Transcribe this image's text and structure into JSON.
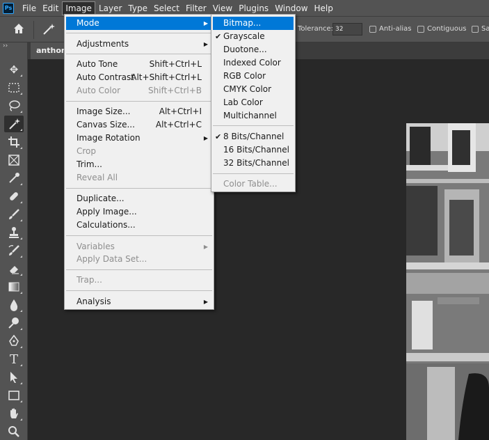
{
  "menubar": {
    "logo": "Ps",
    "items": [
      "File",
      "Edit",
      "Image",
      "Layer",
      "Type",
      "Select",
      "Filter",
      "View",
      "Plugins",
      "Window",
      "Help"
    ]
  },
  "options": {
    "tolerance_label": "Tolerance:",
    "tolerance_value": "32",
    "anti_alias_label": "Anti-alias",
    "contiguous_label": "Contiguous",
    "sample_label": "Sa"
  },
  "toolbar": {
    "collapse": "››"
  },
  "document": {
    "tab_title": "anthony"
  },
  "image_menu": {
    "mode": "Mode",
    "adjustments": "Adjustments",
    "auto_tone": "Auto Tone",
    "auto_tone_sc": "Shift+Ctrl+L",
    "auto_contrast": "Auto Contrast",
    "auto_contrast_sc": "Alt+Shift+Ctrl+L",
    "auto_color": "Auto Color",
    "auto_color_sc": "Shift+Ctrl+B",
    "image_size": "Image Size...",
    "image_size_sc": "Alt+Ctrl+I",
    "canvas_size": "Canvas Size...",
    "canvas_size_sc": "Alt+Ctrl+C",
    "image_rotation": "Image Rotation",
    "crop": "Crop",
    "trim": "Trim...",
    "reveal_all": "Reveal All",
    "duplicate": "Duplicate...",
    "apply_image": "Apply Image...",
    "calculations": "Calculations...",
    "variables": "Variables",
    "apply_data_set": "Apply Data Set...",
    "trap": "Trap...",
    "analysis": "Analysis"
  },
  "mode_menu": {
    "bitmap": "Bitmap...",
    "grayscale": "Grayscale",
    "duotone": "Duotone...",
    "indexed_color": "Indexed Color",
    "rgb_color": "RGB Color",
    "cmyk_color": "CMYK Color",
    "lab_color": "Lab Color",
    "multichannel": "Multichannel",
    "bits8": "8 Bits/Channel",
    "bits16": "16 Bits/Channel",
    "bits32": "32 Bits/Channel",
    "color_table": "Color Table..."
  },
  "colors": {
    "accent": "#0078d7",
    "panel": "#535353",
    "workspace": "#282828"
  }
}
